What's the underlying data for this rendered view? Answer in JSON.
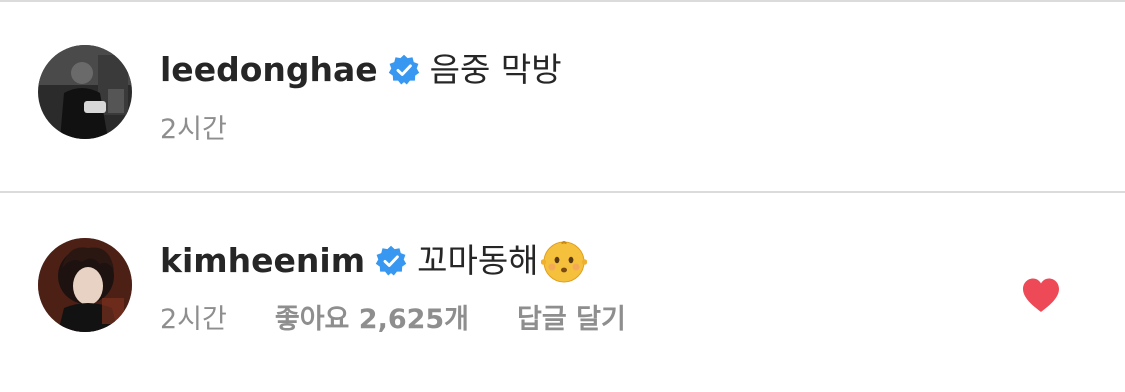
{
  "comments": [
    {
      "username": "leedonghae",
      "verified": true,
      "text": "음중 막방",
      "time": "2시간",
      "liked": false
    },
    {
      "username": "kimheenim",
      "verified": true,
      "text": "꼬마동해",
      "emoji": "baby-face",
      "time": "2시간",
      "likes": "좋아요 2,625개",
      "reply_label": "답글 달기",
      "liked": true
    }
  ],
  "colors": {
    "verified_badge": "#3897f0",
    "heart": "#ed4956",
    "meta_text": "#8e8e8e",
    "divider": "#dbdbdb"
  },
  "icons": {
    "verified": "verified-badge-icon",
    "like": "heart-icon",
    "emoji": "baby-face-emoji"
  }
}
